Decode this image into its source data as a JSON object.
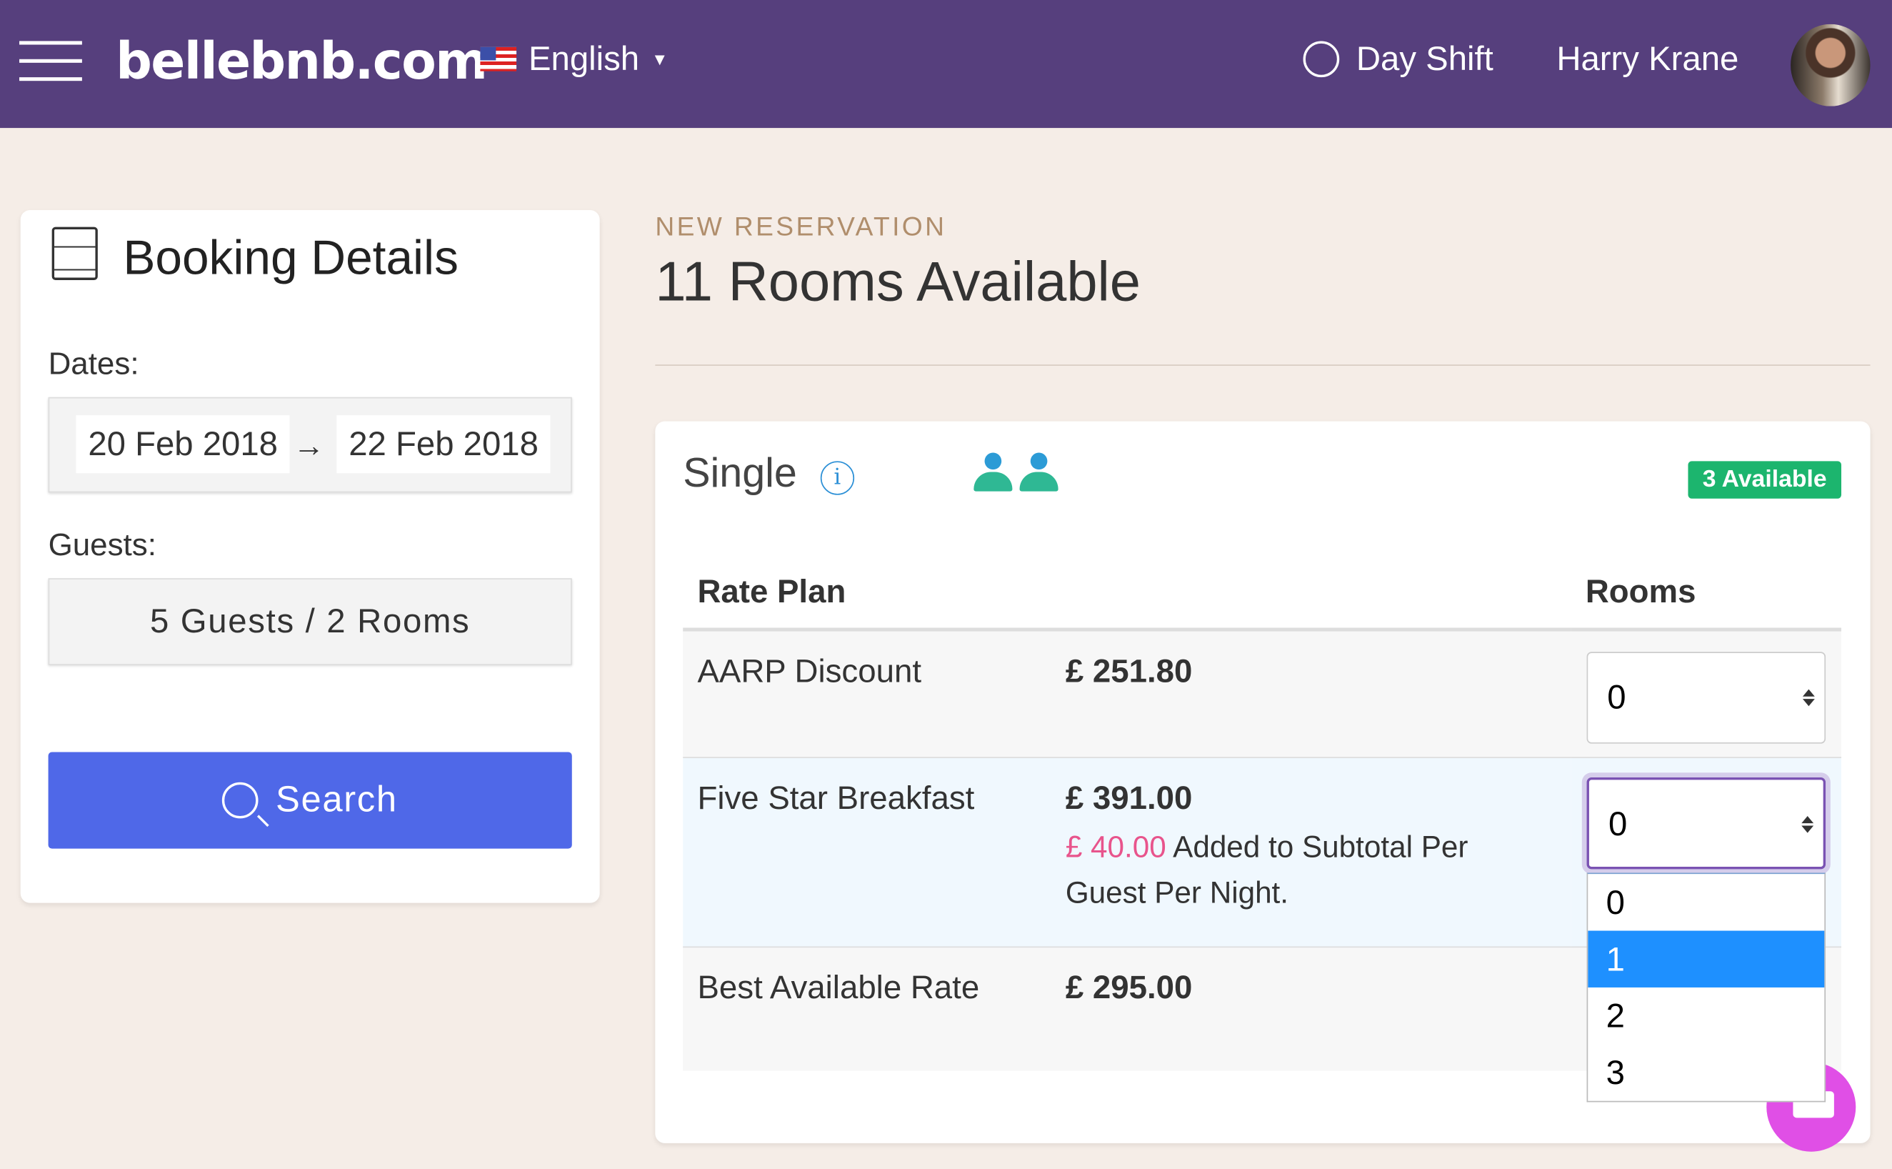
{
  "header": {
    "logo": "bellebnb.com",
    "language": "English",
    "shift": "Day Shift",
    "user": "Harry Krane",
    "colors": {
      "bar": "#563f7d"
    }
  },
  "booking": {
    "title": "Booking Details",
    "dates_label": "Dates:",
    "date_from": "20 Feb 2018",
    "arrow": "→",
    "date_to": "22 Feb 2018",
    "guests_label": "Guests:",
    "guests": "5 Guests / 2 Rooms",
    "search": "Search",
    "search_color": "#4f68e8"
  },
  "main": {
    "eyebrow": "NEW RESERVATION",
    "title": "11 Rooms Available"
  },
  "room": {
    "name": "Single",
    "available": "3 Available",
    "info_icon": "i",
    "headers": {
      "plan": "Rate Plan",
      "rooms": "Rooms"
    },
    "rates": [
      {
        "name": "AARP Discount",
        "price": "£ 251.80",
        "rooms": "0"
      },
      {
        "name": "Five Star Breakfast",
        "price": "£ 391.00",
        "addon_price": "£ 40.00",
        "addon_text": " Added to Subtotal Per Guest Per Night.",
        "rooms": "0"
      },
      {
        "name": "Best Available Rate",
        "price": "£ 295.00"
      }
    ],
    "dropdown_options": [
      "0",
      "1",
      "2",
      "3"
    ],
    "dropdown_highlighted": "1"
  }
}
